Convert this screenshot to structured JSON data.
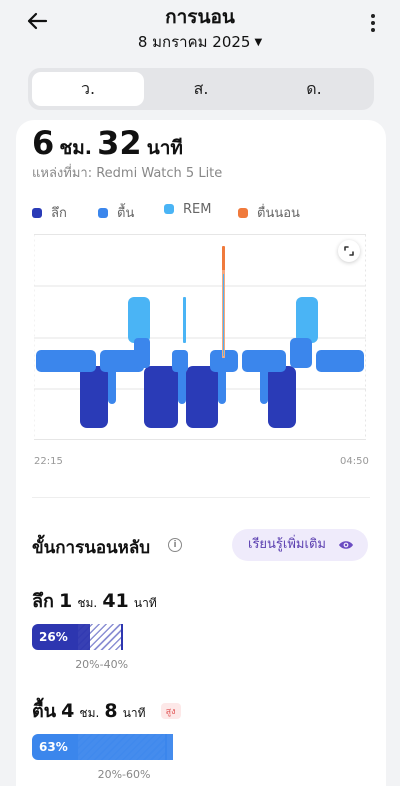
{
  "header": {
    "title": "การนอน",
    "date": "8 มกราคม 2025"
  },
  "tabs": [
    "ว.",
    "ส.",
    "ด."
  ],
  "summary": {
    "hours": "6",
    "hours_unit": "ชม.",
    "minutes": "32",
    "minutes_unit": "นาที",
    "source": "แหล่งที่มา: Redmi Watch 5 Lite"
  },
  "legend": [
    {
      "label": "ลึก",
      "color": "#2a3bb7"
    },
    {
      "label": "ตื้น",
      "color": "#3b86ec"
    },
    {
      "label": "REM",
      "color": "#4ab4f5"
    },
    {
      "label": "ตื่นนอน",
      "color": "#f07a3c"
    }
  ],
  "chart": {
    "start_time": "22:15",
    "end_time": "04:50"
  },
  "stages_section": {
    "title": "ขั้นการนอนหลับ",
    "learn_more": "เรียนรู้เพิ่มเติม"
  },
  "stages": [
    {
      "name": "ลึก",
      "hours": "1",
      "hours_unit": "ชม.",
      "minutes": "41",
      "minutes_unit": "นาที",
      "badge": "",
      "percent_label": "26%",
      "percent": 26,
      "range": "20%-40%",
      "range_low": 20,
      "range_high": 40,
      "color": "#2d36b0"
    },
    {
      "name": "ตื้น",
      "hours": "4",
      "hours_unit": "ชม.",
      "minutes": "8",
      "minutes_unit": "นาที",
      "badge": "สูง",
      "percent_label": "63%",
      "percent": 63,
      "range": "20%-60%",
      "range_low": 20,
      "range_high": 60,
      "color": "#3b86ec"
    }
  ]
}
